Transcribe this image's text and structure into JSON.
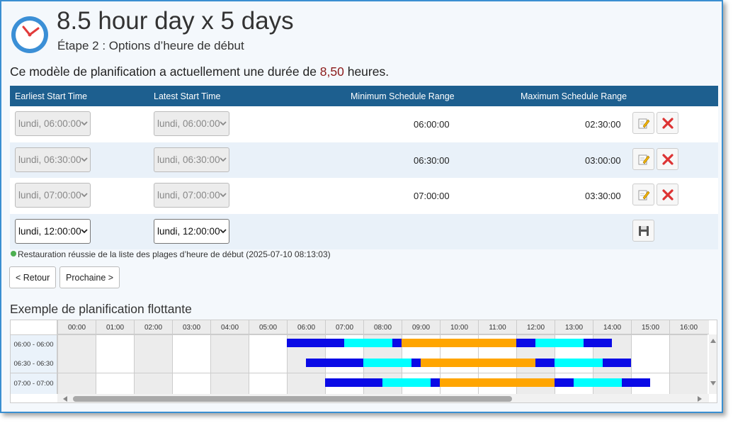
{
  "header": {
    "title": "8.5 hour day x 5 days",
    "subtitle": "Étape 2 : Options d’heure de début",
    "desc_prefix": "Ce modèle de planification a actuellement une durée de ",
    "desc_value": "8,50",
    "desc_suffix": " heures."
  },
  "table": {
    "columns": [
      "Earliest Start Time",
      "Latest Start Time",
      "Minimum Schedule Range",
      "Maximum Schedule Range"
    ],
    "rows": [
      {
        "earliest": "lundi, 06:00:00",
        "latest": "lundi, 06:00:00",
        "min": "06:00:00",
        "max": "02:30:00"
      },
      {
        "earliest": "lundi, 06:30:00",
        "latest": "lundi, 06:30:00",
        "min": "06:30:00",
        "max": "03:00:00"
      },
      {
        "earliest": "lundi, 07:00:00",
        "latest": "lundi, 07:00:00",
        "min": "07:00:00",
        "max": "03:30:00"
      }
    ],
    "new_row": {
      "earliest": "lundi, 12:00:00",
      "latest": "lundi, 12:00:00"
    }
  },
  "status": "Restauration réussie de la liste des plages d’heure de début (2025-07-10 08:13:03)",
  "nav": {
    "back": "< Retour",
    "next": "Prochaine >"
  },
  "example": {
    "title": "Exemple de planification flottante",
    "hours": [
      "00:00",
      "01:00",
      "02:00",
      "03:00",
      "04:00",
      "05:00",
      "06:00",
      "07:00",
      "08:00",
      "09:00",
      "10:00",
      "11:00",
      "12:00",
      "13:00",
      "14:00",
      "15:00",
      "16:00"
    ],
    "rows": [
      "06:00 - 06:00",
      "06:30 - 06:30",
      "07:00 - 07:00"
    ],
    "colors": {
      "blue": "#0a0ae6",
      "cyan": "#00ffff",
      "orange": "#ffa500"
    }
  }
}
